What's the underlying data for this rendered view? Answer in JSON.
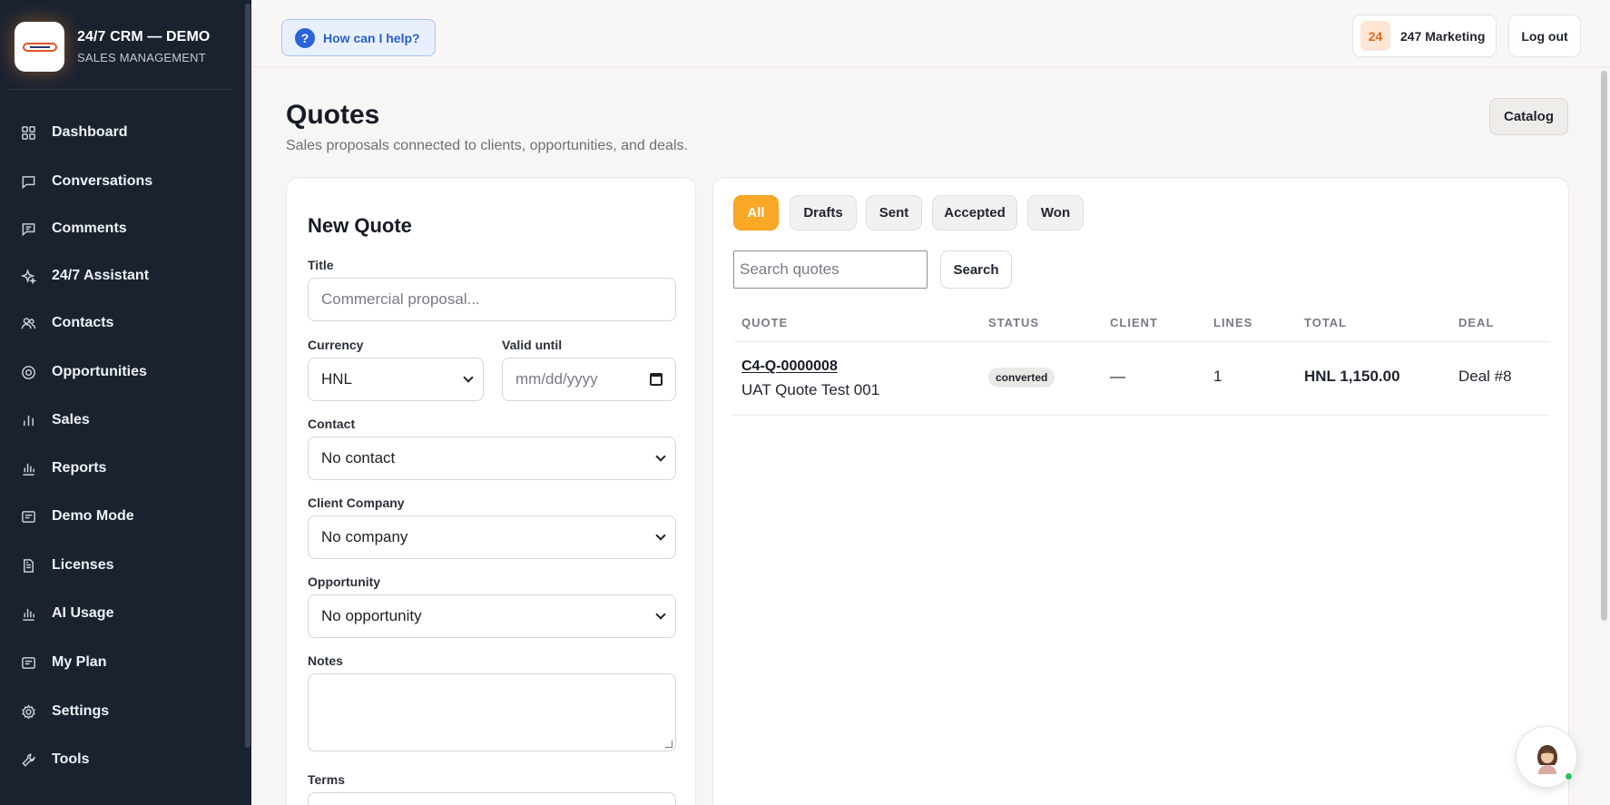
{
  "brand": {
    "title": "24/7 CRM — DEMO",
    "subtitle": "SALES MANAGEMENT"
  },
  "sidebar": {
    "items": [
      {
        "label": "Dashboard",
        "icon": "grid-icon"
      },
      {
        "label": "Conversations",
        "icon": "chat-icon"
      },
      {
        "label": "Comments",
        "icon": "comment-icon"
      },
      {
        "label": "24/7 Assistant",
        "icon": "sparkle-icon"
      },
      {
        "label": "Contacts",
        "icon": "users-icon"
      },
      {
        "label": "Opportunities",
        "icon": "target-icon"
      },
      {
        "label": "Sales",
        "icon": "bar-chart-icon"
      },
      {
        "label": "Reports",
        "icon": "reports-icon"
      },
      {
        "label": "Demo Mode",
        "icon": "screen-icon"
      },
      {
        "label": "Licenses",
        "icon": "document-icon"
      },
      {
        "label": "AI Usage",
        "icon": "usage-chart-icon"
      },
      {
        "label": "My Plan",
        "icon": "plan-icon"
      },
      {
        "label": "Settings",
        "icon": "gear-icon"
      },
      {
        "label": "Tools",
        "icon": "tools-icon"
      }
    ]
  },
  "topbar": {
    "help_label": "How can I help?",
    "help_icon": "?",
    "account_badge": "24",
    "account_name": "247 Marketing",
    "logout_label": "Log out"
  },
  "page": {
    "title": "Quotes",
    "subtitle": "Sales proposals connected to clients, opportunities, and deals.",
    "catalog_label": "Catalog"
  },
  "form": {
    "title": "New Quote",
    "title_label": "Title",
    "title_placeholder": "Commercial proposal...",
    "currency_label": "Currency",
    "currency_value": "HNL",
    "valid_until_label": "Valid until",
    "valid_until_placeholder": "mm/dd/yyyy",
    "contact_label": "Contact",
    "contact_value": "No contact",
    "company_label": "Client Company",
    "company_value": "No company",
    "opportunity_label": "Opportunity",
    "opportunity_value": "No opportunity",
    "notes_label": "Notes",
    "terms_label": "Terms"
  },
  "filters": [
    "All",
    "Drafts",
    "Sent",
    "Accepted",
    "Won"
  ],
  "active_filter": "All",
  "search": {
    "placeholder": "Search quotes",
    "button_label": "Search"
  },
  "table": {
    "headers": [
      "QUOTE",
      "STATUS",
      "CLIENT",
      "LINES",
      "TOTAL",
      "DEAL"
    ],
    "rows": [
      {
        "code": "C4-Q-0000008",
        "name": "UAT Quote Test 001",
        "status": "converted",
        "client": "—",
        "lines": "1",
        "total": "HNL 1,150.00",
        "deal": "Deal #8"
      }
    ]
  },
  "colors": {
    "sidebar_bg": "#1a2230",
    "accent": "#f9a825",
    "help_blue": "#2a63d8",
    "online": "#22c55e"
  }
}
